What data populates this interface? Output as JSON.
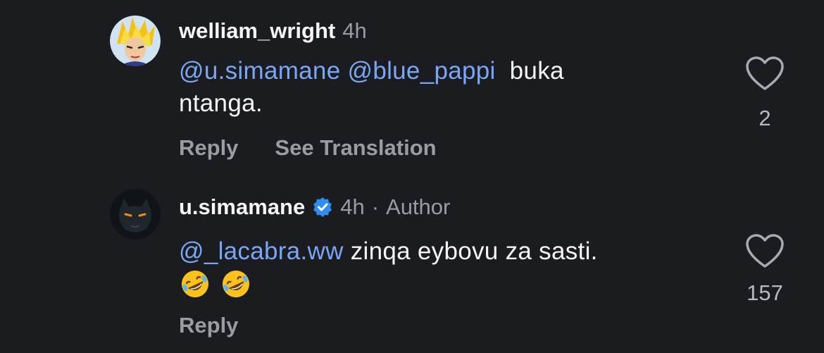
{
  "comments": [
    {
      "username": "welliam_wright",
      "time": "4h",
      "author_tag": "",
      "mentions": [
        "@u.simamane",
        "@blue_pappi"
      ],
      "text_line1": "buka",
      "text_line2": "ntanga.",
      "reply_label": "Reply",
      "translate_label": "See Translation",
      "like_count": "2",
      "avatar_icon": "dragon-ball-character-avatar"
    },
    {
      "username": "u.simamane",
      "verified": true,
      "time": "4h",
      "separator": "·",
      "author_tag": "Author",
      "mention": "@_lacabra.ww",
      "text": "zinqa eybovu za sasti.",
      "emojis": [
        "rolling-on-floor-laughing-emoji",
        "rolling-on-floor-laughing-emoji"
      ],
      "reply_label": "Reply",
      "like_count": "157",
      "avatar_icon": "panther-avatar"
    }
  ],
  "colors": {
    "background": "#1b1c20",
    "mention": "#7aa6f5",
    "muted": "#9a9ca3",
    "verified": "#2f8cf0"
  }
}
